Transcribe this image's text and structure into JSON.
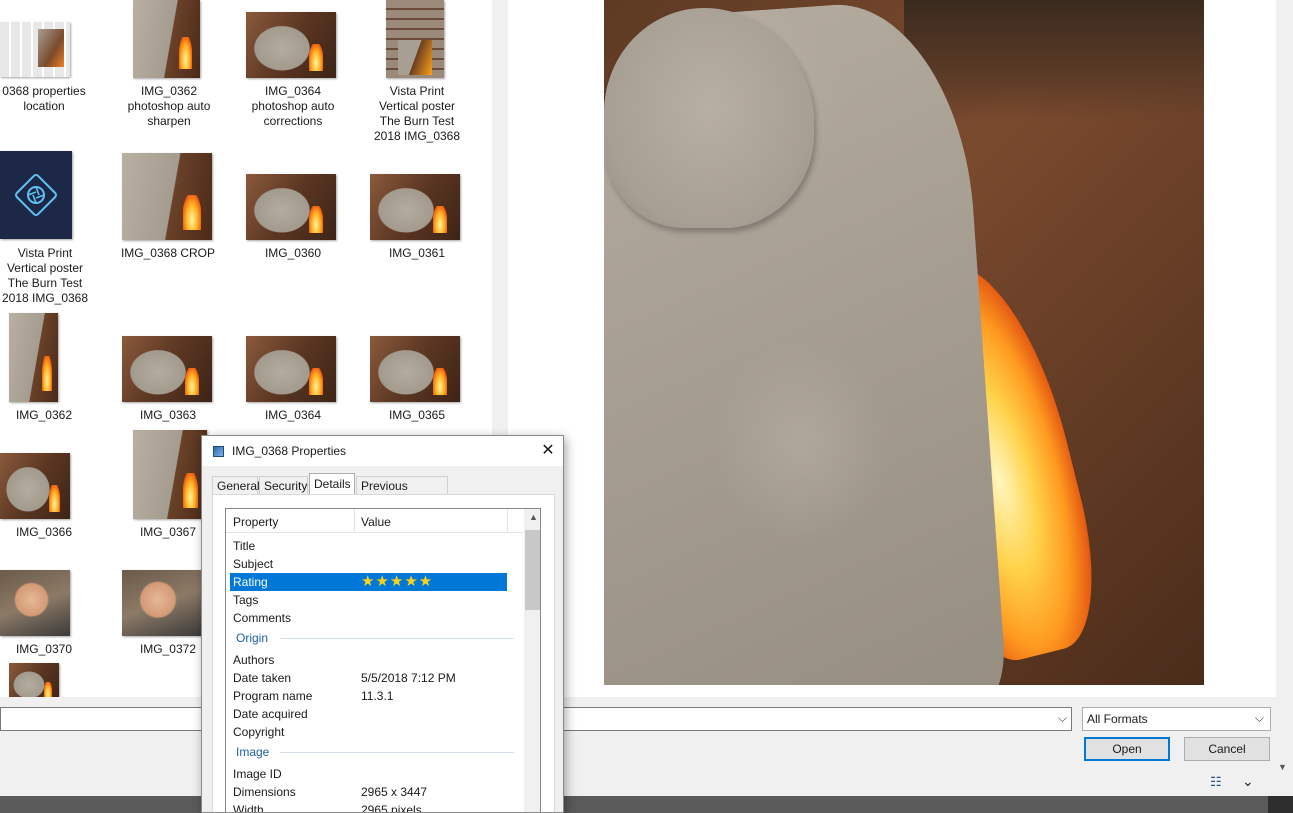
{
  "files": [
    {
      "name": "0368 properties\nlocation"
    },
    {
      "name": "IMG_0362\nphotoshop auto\nsharpen"
    },
    {
      "name": "IMG_0364\nphotoshop auto\ncorrections"
    },
    {
      "name": "Vista Print\nVertical poster\nThe Burn Test\n2018 IMG_0368"
    },
    {
      "name": "Vista Print\nVertical poster\nThe Burn Test\n2018 IMG_0368"
    },
    {
      "name": "IMG_0368 CROP"
    },
    {
      "name": "IMG_0360"
    },
    {
      "name": "IMG_0361"
    },
    {
      "name": "IMG_0362"
    },
    {
      "name": "IMG_0363"
    },
    {
      "name": "IMG_0364"
    },
    {
      "name": "IMG_0365"
    },
    {
      "name": "IMG_0366"
    },
    {
      "name": "IMG_0367"
    },
    {
      "name": "IMG_0370"
    },
    {
      "name": "IMG_0372"
    }
  ],
  "controls": {
    "filename_value": "",
    "format_selected": "All Formats",
    "open_label": "Open",
    "cancel_label": "Cancel"
  },
  "properties_dialog": {
    "title": "IMG_0368 Properties",
    "close_glyph": "✕",
    "tabs": [
      "General",
      "Security",
      "Details",
      "Previous Versions"
    ],
    "active_tab": "Details",
    "columns": {
      "property": "Property",
      "value": "Value"
    },
    "rows": {
      "title": {
        "k": "Title",
        "v": ""
      },
      "subject": {
        "k": "Subject",
        "v": ""
      },
      "rating": {
        "k": "Rating",
        "stars": "★★★★★"
      },
      "tags": {
        "k": "Tags",
        "v": ""
      },
      "comments": {
        "k": "Comments",
        "v": ""
      },
      "authors": {
        "k": "Authors",
        "v": ""
      },
      "date_taken": {
        "k": "Date taken",
        "v": "5/5/2018 7:12 PM"
      },
      "program_name": {
        "k": "Program name",
        "v": "11.3.1"
      },
      "date_acquired": {
        "k": "Date acquired",
        "v": ""
      },
      "copyright": {
        "k": "Copyright",
        "v": ""
      },
      "image_id": {
        "k": "Image ID",
        "v": ""
      },
      "dimensions": {
        "k": "Dimensions",
        "v": "2965 x 3447"
      },
      "width": {
        "k": "Width",
        "v": "2965 pixels"
      }
    },
    "groups": {
      "origin": "Origin",
      "image": "Image"
    }
  },
  "icons": {
    "chevron_down": "⌵",
    "view_options": "☷",
    "collapse": "⌄",
    "scroll_up": "▲",
    "scroll_down": "▼"
  },
  "colors": {
    "selection": "#0078d7",
    "star": "#ffd21a",
    "group_heading": "#1f5fa8"
  }
}
